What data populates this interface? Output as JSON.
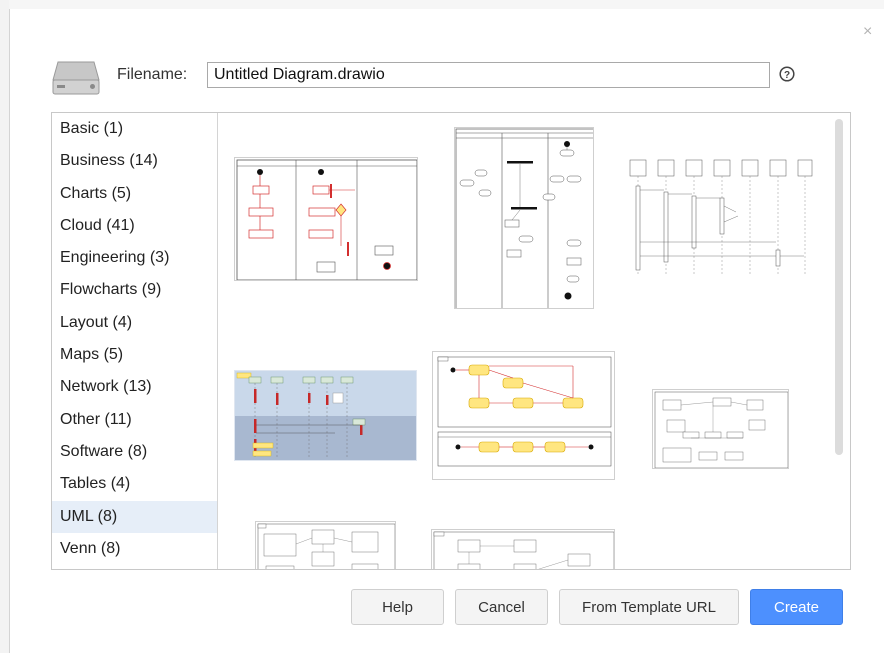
{
  "dialog": {
    "close_glyph": "×",
    "filename_label": "Filename:",
    "filename_value": "Untitled Diagram.drawio",
    "help_glyph": "?"
  },
  "categories": [
    {
      "label": "Basic (1)"
    },
    {
      "label": "Business (14)"
    },
    {
      "label": "Charts (5)"
    },
    {
      "label": "Cloud (41)"
    },
    {
      "label": "Engineering (3)"
    },
    {
      "label": "Flowcharts (9)"
    },
    {
      "label": "Layout (4)"
    },
    {
      "label": "Maps (5)"
    },
    {
      "label": "Network (13)"
    },
    {
      "label": "Other (11)"
    },
    {
      "label": "Software (8)"
    },
    {
      "label": "Tables (4)"
    },
    {
      "label": "UML (8)",
      "selected": true
    },
    {
      "label": "Venn (8)"
    }
  ],
  "buttons": {
    "help": "Help",
    "cancel": "Cancel",
    "from_template_url": "From Template URL",
    "create": "Create"
  },
  "colors": {
    "accent": "#4d90fe",
    "selected_category": "#e6eef8",
    "template_red": "#d32f2f",
    "template_yellow": "#ffe680"
  }
}
